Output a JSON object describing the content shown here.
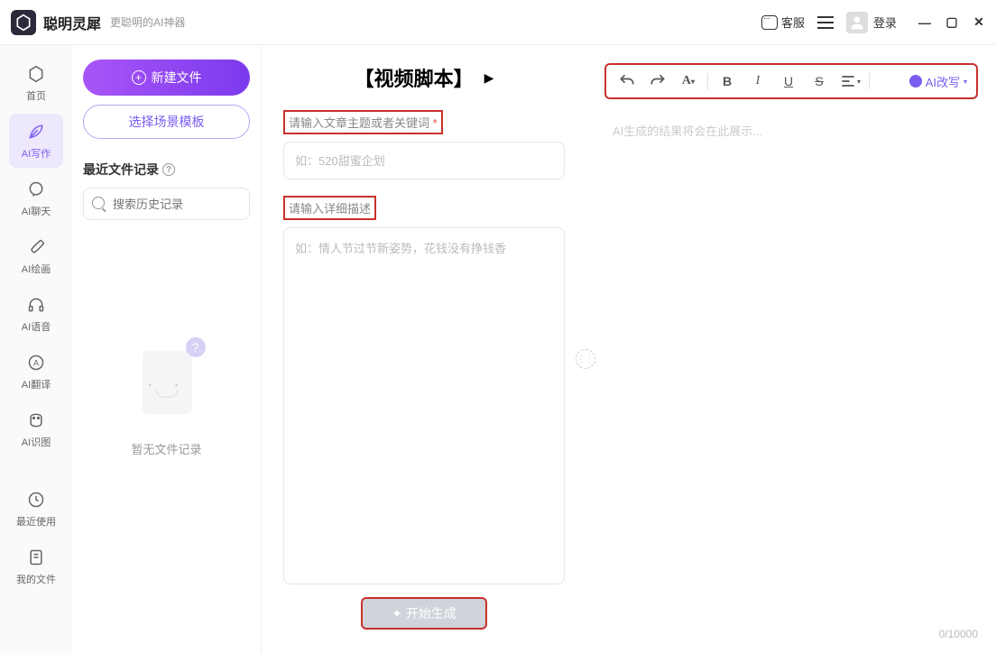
{
  "titlebar": {
    "app_name": "聪明灵犀",
    "app_sub": "更聪明的AI神器",
    "kefu": "客服",
    "login": "登录"
  },
  "sidebar": {
    "items": [
      {
        "label": "首页"
      },
      {
        "label": "AI写作"
      },
      {
        "label": "AI聊天"
      },
      {
        "label": "AI绘画"
      },
      {
        "label": "AI语音"
      },
      {
        "label": "AI翻译"
      },
      {
        "label": "AI识图"
      },
      {
        "label": "最近使用"
      },
      {
        "label": "我的文件"
      }
    ]
  },
  "filepanel": {
    "new_file": "新建文件",
    "select_template": "选择场景模板",
    "recent_title": "最近文件记录",
    "search_placeholder": "搜索历史记录",
    "empty_text": "暂无文件记录"
  },
  "midpanel": {
    "title": "【视频脚本】",
    "label_topic": "请输入文章主题或者关键词",
    "placeholder_topic": "如：520甜蜜企划",
    "label_detail": "请输入详细描述",
    "placeholder_detail": "如：情人节过节新姿势，花钱没有挣钱香",
    "btn_generate": "开始生成"
  },
  "rightpanel": {
    "ai_rewrite": "AI改写",
    "output_placeholder": "AI生成的结果将会在此展示...",
    "counter": "0/10000"
  }
}
